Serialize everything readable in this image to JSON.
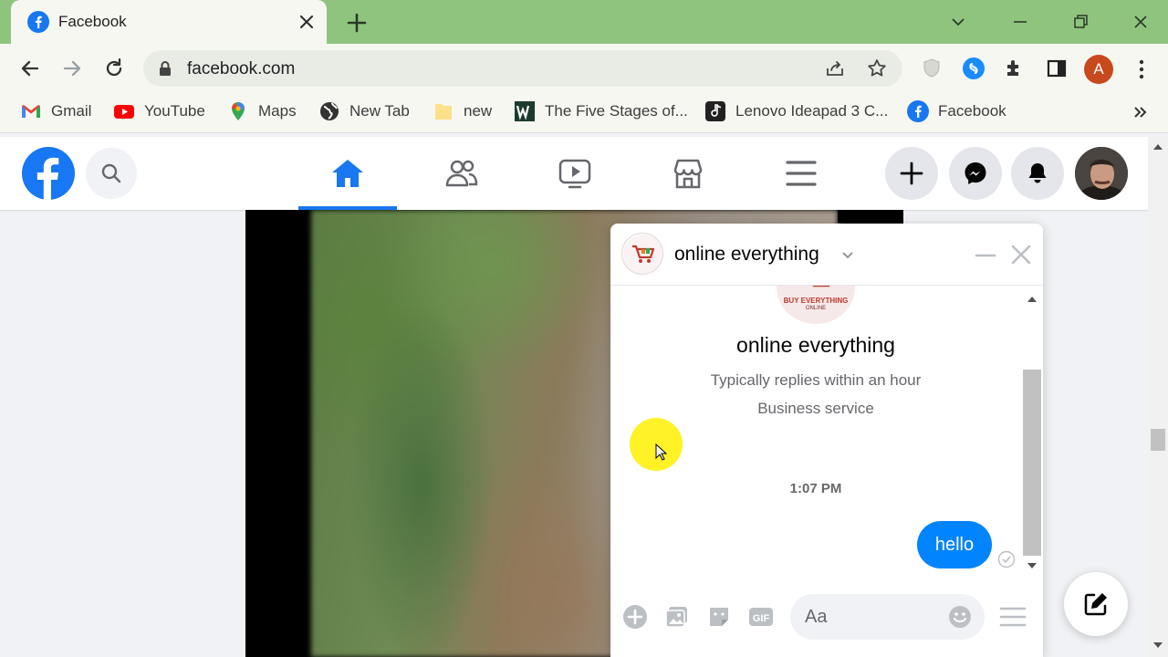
{
  "browser": {
    "tab": {
      "title": "Facebook"
    },
    "url": "facebook.com",
    "profile_initial": "A",
    "bookmarks": [
      {
        "label": "Gmail",
        "icon": "gmail-icon"
      },
      {
        "label": "YouTube",
        "icon": "youtube-icon"
      },
      {
        "label": "Maps",
        "icon": "maps-icon"
      },
      {
        "label": "New Tab",
        "icon": "globe-icon"
      },
      {
        "label": "new",
        "icon": "folder-icon"
      },
      {
        "label": "The Five Stages of...",
        "icon": "w-icon"
      },
      {
        "label": "Lenovo Ideapad 3 C...",
        "icon": "music-note-icon"
      },
      {
        "label": "Facebook",
        "icon": "facebook-icon"
      }
    ],
    "colors": {
      "tabstrip": "#8fc47f",
      "toolbar": "#f7f7f2",
      "avatar": "#c8491d"
    }
  },
  "facebook": {
    "colors": {
      "brand": "#1877f2",
      "bubble": "#0084ff"
    }
  },
  "chat": {
    "title": "online everything",
    "profile": {
      "name": "online everything",
      "reply_time": "Typically replies within an hour",
      "category": "Business service",
      "logo_text": "BUY EVERYTHING",
      "logo_sub": "ONLINE"
    },
    "timestamp": "1:07 PM",
    "messages": [
      {
        "text": "hello",
        "from": "me"
      }
    ],
    "composer_placeholder": "Aa"
  }
}
